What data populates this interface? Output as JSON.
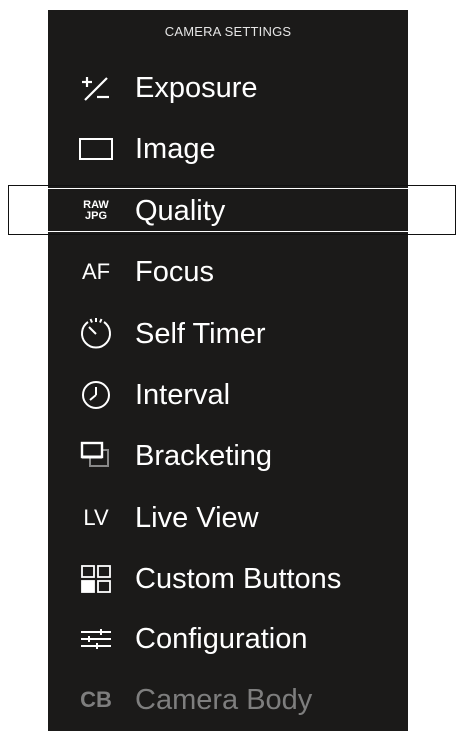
{
  "menu": {
    "title": "CAMERA SETTINGS",
    "items": [
      {
        "label": "Exposure",
        "icon": "plus-minus-icon"
      },
      {
        "label": "Image",
        "icon": "rectangle-icon"
      },
      {
        "label": "Quality",
        "icon": "raw-jpg-icon",
        "icon_text_top": "RAW",
        "icon_text_bottom": "JPG",
        "selected": true
      },
      {
        "label": "Focus",
        "icon": "af-icon",
        "icon_text": "AF"
      },
      {
        "label": "Self Timer",
        "icon": "self-timer-icon"
      },
      {
        "label": "Interval",
        "icon": "interval-clock-icon"
      },
      {
        "label": "Bracketing",
        "icon": "bracketing-icon"
      },
      {
        "label": "Live View",
        "icon": "lv-icon",
        "icon_text": "LV"
      },
      {
        "label": "Custom Buttons",
        "icon": "custom-buttons-icon"
      },
      {
        "label": "Configuration",
        "icon": "configuration-sliders-icon"
      },
      {
        "label": "Camera Body",
        "icon": "cb-icon",
        "icon_text": "CB",
        "disabled": true
      }
    ]
  },
  "colors": {
    "panel_background": "#1b1a19",
    "text": "#ffffff",
    "disabled_text": "#7e7e7e",
    "selection_outline": "#ffffff"
  }
}
